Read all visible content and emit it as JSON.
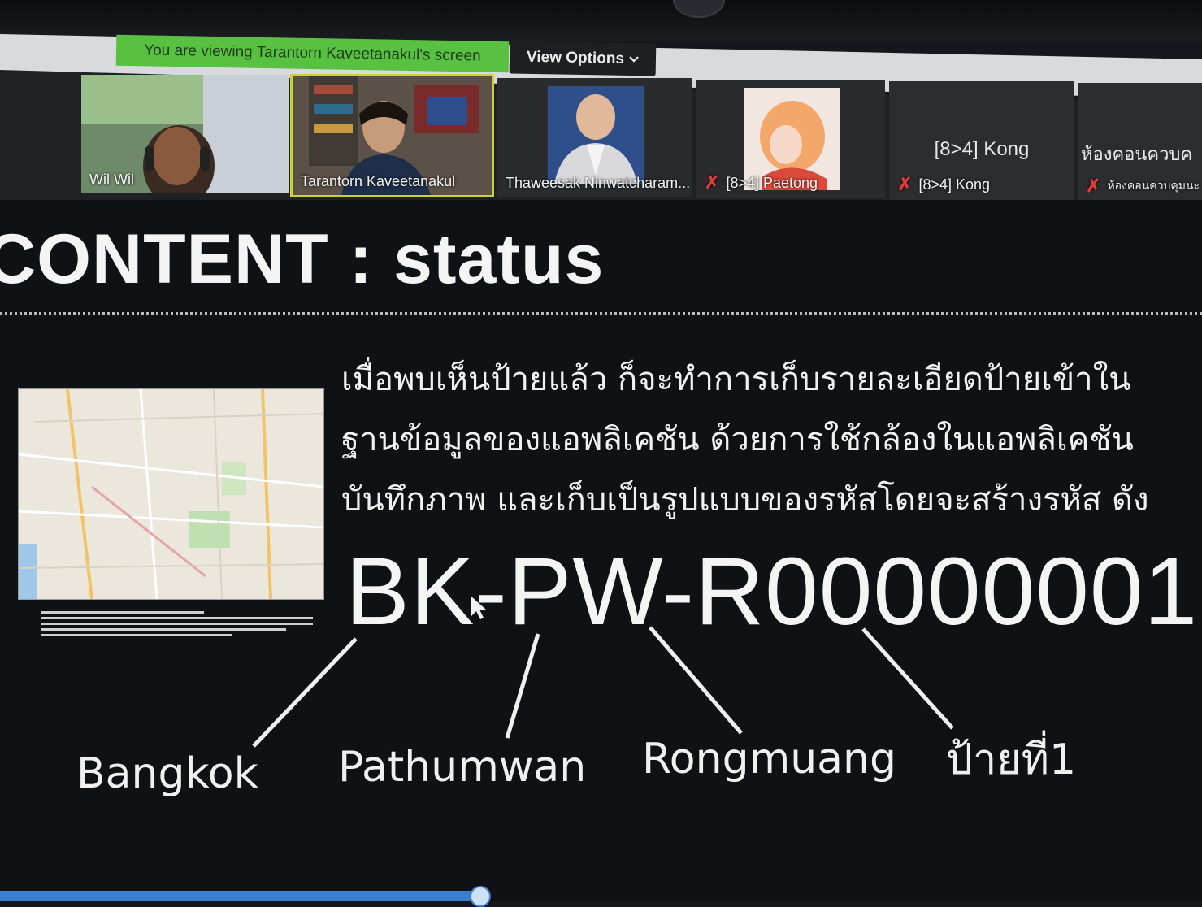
{
  "banner": {
    "viewing_text": "You are viewing Tarantorn Kaveetanakul's screen",
    "view_options_label": "View Options",
    "view_options_icon": "chevron-down-icon"
  },
  "participants": [
    {
      "name": "Wil Wil",
      "muted": false
    },
    {
      "name": "Tarantorn Kaveetanakul",
      "muted": false,
      "active_speaker": true
    },
    {
      "name": "Thaweesak Ninwatcharam...",
      "muted": false
    },
    {
      "name": "[8>4] Paetong",
      "muted": true
    },
    {
      "name": "[8>4] Kong",
      "display_name": "[8>4] Kong",
      "muted": true
    },
    {
      "name": "ห้องคอนควบคุมนะ",
      "display_name": "ห้องคอนควบค",
      "muted": true
    }
  ],
  "slide": {
    "title": "CONTENT : status",
    "paragraph": [
      "เมื่อพบเห็นป้ายแล้ว ก็จะทำการเก็บรายละเอียดป้ายเข้าใน",
      "ฐานข้อมูลของแอพลิเคชัน ด้วยการใช้กล้องในแอพลิเคชัน",
      "บันทึกภาพ และเก็บเป็นรูปแบบของรหัสโดยจะสร้างรหัส ดัง"
    ],
    "code": "BK-PW-R00000001",
    "labels": {
      "bangkok": "Bangkok",
      "pathumwan": "Pathumwan",
      "rongmuang": "Rongmuang",
      "sign_one": "ป้ายที่1"
    }
  },
  "colors": {
    "banner_green": "#59c142",
    "slide_bg": "#0f1115",
    "mute_red": "#e33b3b",
    "active_speaker": "#c9d234",
    "progress_blue": "#3a7fd0"
  }
}
